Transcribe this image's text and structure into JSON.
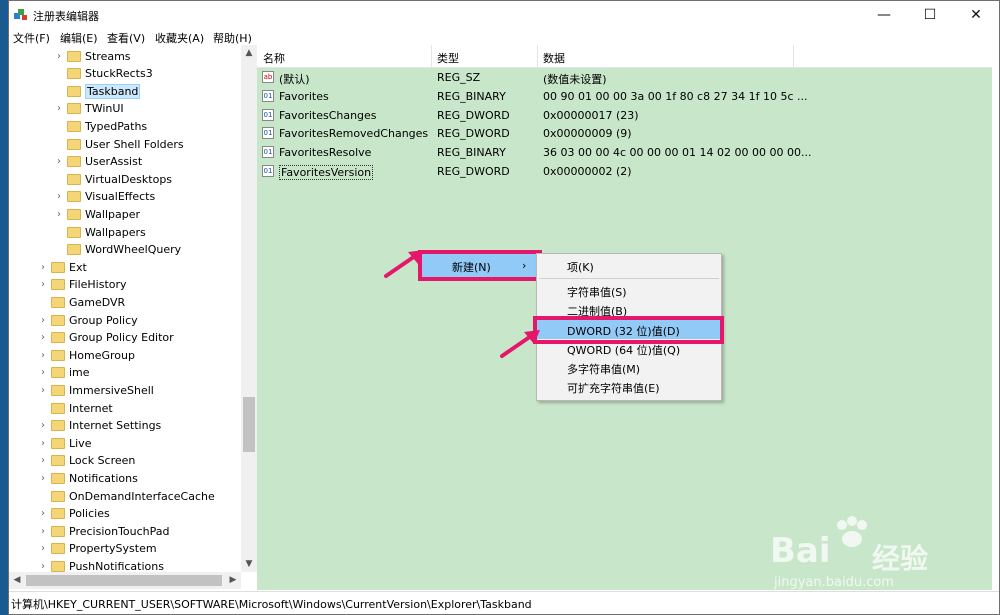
{
  "window": {
    "title": "注册表编辑器",
    "minimize": "—",
    "maximize": "☐",
    "close": "✕"
  },
  "menu": [
    "文件(F)",
    "编辑(E)",
    "查看(V)",
    "收藏夹(A)",
    "帮助(H)"
  ],
  "tree": {
    "items": [
      {
        "label": "Streams",
        "indent": 2,
        "expand": true
      },
      {
        "label": "StuckRects3",
        "indent": 2,
        "expand": false
      },
      {
        "label": "Taskband",
        "indent": 2,
        "expand": false,
        "selected": true
      },
      {
        "label": "TWinUI",
        "indent": 2,
        "expand": true
      },
      {
        "label": "TypedPaths",
        "indent": 2,
        "expand": false
      },
      {
        "label": "User Shell Folders",
        "indent": 2,
        "expand": false
      },
      {
        "label": "UserAssist",
        "indent": 2,
        "expand": true
      },
      {
        "label": "VirtualDesktops",
        "indent": 2,
        "expand": false
      },
      {
        "label": "VisualEffects",
        "indent": 2,
        "expand": true
      },
      {
        "label": "Wallpaper",
        "indent": 2,
        "expand": true
      },
      {
        "label": "Wallpapers",
        "indent": 2,
        "expand": false
      },
      {
        "label": "WordWheelQuery",
        "indent": 2,
        "expand": false
      },
      {
        "label": "Ext",
        "indent": 1,
        "expand": true
      },
      {
        "label": "FileHistory",
        "indent": 1,
        "expand": true
      },
      {
        "label": "GameDVR",
        "indent": 1,
        "expand": false
      },
      {
        "label": "Group Policy",
        "indent": 1,
        "expand": true
      },
      {
        "label": "Group Policy Editor",
        "indent": 1,
        "expand": true
      },
      {
        "label": "HomeGroup",
        "indent": 1,
        "expand": true
      },
      {
        "label": "ime",
        "indent": 1,
        "expand": true
      },
      {
        "label": "ImmersiveShell",
        "indent": 1,
        "expand": true
      },
      {
        "label": "Internet",
        "indent": 1,
        "expand": false
      },
      {
        "label": "Internet Settings",
        "indent": 1,
        "expand": true
      },
      {
        "label": "Live",
        "indent": 1,
        "expand": true
      },
      {
        "label": "Lock Screen",
        "indent": 1,
        "expand": true
      },
      {
        "label": "Notifications",
        "indent": 1,
        "expand": true
      },
      {
        "label": "OnDemandInterfaceCache",
        "indent": 1,
        "expand": false
      },
      {
        "label": "Policies",
        "indent": 1,
        "expand": true
      },
      {
        "label": "PrecisionTouchPad",
        "indent": 1,
        "expand": true
      },
      {
        "label": "PropertySystem",
        "indent": 1,
        "expand": true
      },
      {
        "label": "PushNotifications",
        "indent": 1,
        "expand": true
      }
    ]
  },
  "list": {
    "columns": [
      "名称",
      "类型",
      "数据"
    ],
    "rows": [
      {
        "name": "(默认)",
        "type": "REG_SZ",
        "data": "(数值未设置)",
        "icon": "ab"
      },
      {
        "name": "Favorites",
        "type": "REG_BINARY",
        "data": "00 90 01 00 00 3a 00 1f 80 c8 27 34 1f 10 5c ...",
        "icon": "bin"
      },
      {
        "name": "FavoritesChanges",
        "type": "REG_DWORD",
        "data": "0x00000017 (23)",
        "icon": "bin"
      },
      {
        "name": "FavoritesRemovedChanges",
        "type": "REG_DWORD",
        "data": "0x00000009 (9)",
        "icon": "bin"
      },
      {
        "name": "FavoritesResolve",
        "type": "REG_BINARY",
        "data": "36 03 00 00 4c 00 00 00 01 14 02 00 00 00 00...",
        "icon": "bin"
      },
      {
        "name": "FavoritesVersion",
        "type": "REG_DWORD",
        "data": "0x00000002 (2)",
        "icon": "bin",
        "focused": true
      }
    ]
  },
  "context_menu": {
    "new_label": "新建(N)",
    "arrow": "›"
  },
  "submenu": {
    "items": [
      "项(K)",
      "字符串值(S)",
      "二进制值(B)",
      "DWORD (32 位)值(D)",
      "QWORD (64 位)值(Q)",
      "多字符串值(M)",
      "可扩充字符串值(E)"
    ]
  },
  "status": {
    "path": "计算机\\HKEY_CURRENT_USER\\SOFTWARE\\Microsoft\\Windows\\CurrentVersion\\Explorer\\Taskband"
  },
  "watermark": {
    "brand": "Bai",
    "brand2": "经验",
    "url": "jingyan.baidu.com"
  },
  "colors": {
    "list_bg": "#c8e6c9",
    "highlight": "#91c9f7",
    "annotation": "#e4176a"
  }
}
